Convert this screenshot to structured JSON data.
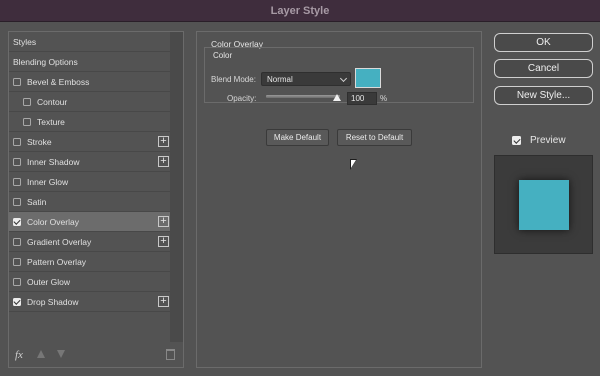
{
  "window": {
    "title": "Layer Style"
  },
  "left_panel": {
    "items": [
      {
        "label": "Styles",
        "checkbox": false,
        "checked": false,
        "selected": false,
        "indent": false,
        "plus": false
      },
      {
        "label": "Blending Options",
        "checkbox": false,
        "checked": false,
        "selected": false,
        "indent": false,
        "plus": false
      },
      {
        "label": "Bevel & Emboss",
        "checkbox": true,
        "checked": false,
        "selected": false,
        "indent": false,
        "plus": false
      },
      {
        "label": "Contour",
        "checkbox": true,
        "checked": false,
        "selected": false,
        "indent": true,
        "plus": false
      },
      {
        "label": "Texture",
        "checkbox": true,
        "checked": false,
        "selected": false,
        "indent": true,
        "plus": false
      },
      {
        "label": "Stroke",
        "checkbox": true,
        "checked": false,
        "selected": false,
        "indent": false,
        "plus": true
      },
      {
        "label": "Inner Shadow",
        "checkbox": true,
        "checked": false,
        "selected": false,
        "indent": false,
        "plus": true
      },
      {
        "label": "Inner Glow",
        "checkbox": true,
        "checked": false,
        "selected": false,
        "indent": false,
        "plus": false
      },
      {
        "label": "Satin",
        "checkbox": true,
        "checked": false,
        "selected": false,
        "indent": false,
        "plus": false
      },
      {
        "label": "Color Overlay",
        "checkbox": true,
        "checked": true,
        "selected": true,
        "indent": false,
        "plus": true
      },
      {
        "label": "Gradient Overlay",
        "checkbox": true,
        "checked": false,
        "selected": false,
        "indent": false,
        "plus": true
      },
      {
        "label": "Pattern Overlay",
        "checkbox": true,
        "checked": false,
        "selected": false,
        "indent": false,
        "plus": false
      },
      {
        "label": "Outer Glow",
        "checkbox": true,
        "checked": false,
        "selected": false,
        "indent": false,
        "plus": false
      },
      {
        "label": "Drop Shadow",
        "checkbox": true,
        "checked": true,
        "selected": false,
        "indent": false,
        "plus": true
      }
    ],
    "footer": {
      "fx_label": "fx",
      "icons": [
        "move-up-icon",
        "move-down-icon",
        "trash-icon"
      ]
    }
  },
  "color_overlay": {
    "section_title": "Color Overlay",
    "group_title": "Color",
    "blend_mode_label": "Blend Mode:",
    "blend_mode_value": "Normal",
    "color_hex": "#45b0c1",
    "opacity_label": "Opacity:",
    "opacity_value": "100",
    "opacity_unit": "%",
    "make_default_label": "Make Default",
    "reset_default_label": "Reset to Default"
  },
  "right_panel": {
    "ok_label": "OK",
    "cancel_label": "Cancel",
    "new_style_label": "New Style...",
    "preview_label": "Preview",
    "preview_checked": true
  }
}
